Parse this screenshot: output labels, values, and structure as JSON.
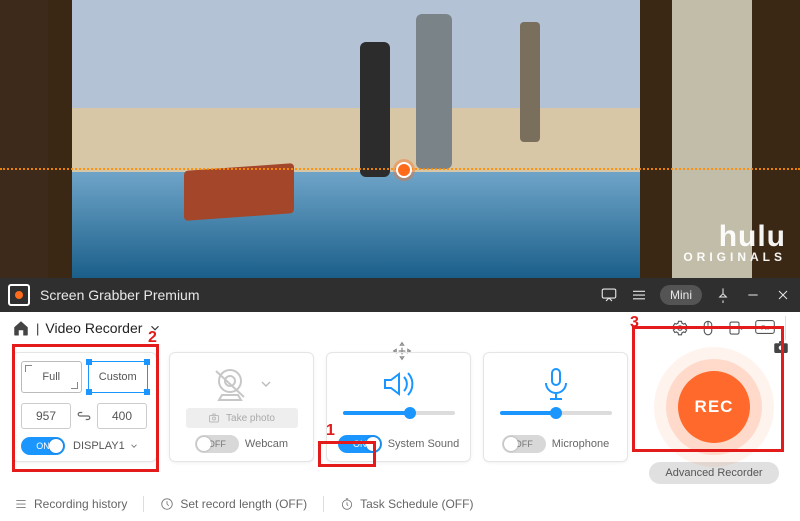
{
  "preview": {
    "brand_main": "hulu",
    "brand_sub": "ORIGINALS"
  },
  "titlebar": {
    "app_name": "Screen Grabber Premium",
    "mini_label": "Mini"
  },
  "toolbar": {
    "tab_label": "Video Recorder"
  },
  "cards": {
    "display": {
      "mode_full": "Full",
      "mode_custom": "Custom",
      "width": "957",
      "height": "400",
      "toggle_state": "ON",
      "output_label": "DISPLAY1"
    },
    "webcam": {
      "toggle_state": "OFF",
      "label": "Webcam",
      "take_photo": "Take photo"
    },
    "system_sound": {
      "toggle_state": "ON",
      "label": "System Sound",
      "volume_percent": 60
    },
    "microphone": {
      "toggle_state": "OFF",
      "label": "Microphone",
      "volume_percent": 50
    }
  },
  "record": {
    "rec_label": "REC",
    "advanced_label": "Advanced Recorder"
  },
  "footer": {
    "history": "Recording history",
    "rec_length": "Set record length (OFF)",
    "schedule": "Task Schedule (OFF)"
  },
  "annotations": {
    "n1": "1",
    "n2": "2",
    "n3": "3"
  }
}
